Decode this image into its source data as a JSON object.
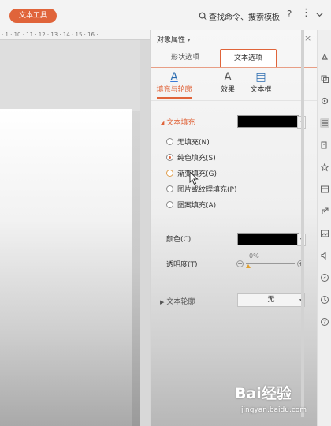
{
  "toolbar": {
    "tool_tab": "文本工具",
    "search_label": "查找命令、搜索模板",
    "help": "?",
    "more": "⋮"
  },
  "ruler": {
    "ticks": "· 1 · 10 · 11 · 12 · 13 · 14 · 15 · 16 ·"
  },
  "panel": {
    "title": "对象属性",
    "title_caret": "▾",
    "close": "×",
    "tabs": [
      {
        "label": "形状选项"
      },
      {
        "label": "文本选项",
        "active": true
      }
    ],
    "sub_tabs": [
      {
        "label": "填充与轮廓",
        "glyph": "A",
        "active": true
      },
      {
        "label": "效果",
        "glyph": "A"
      },
      {
        "label": "文本框",
        "glyph": "▤"
      }
    ],
    "fill_section": {
      "title": "文本填充",
      "color": "#000000",
      "options": [
        {
          "label": "无填充(N)",
          "selected": false
        },
        {
          "label": "纯色填充(S)",
          "selected": true
        },
        {
          "label": "渐变填充(G)",
          "selected": false,
          "hover": true
        },
        {
          "label": "图片或纹理填充(P)",
          "selected": false
        },
        {
          "label": "图案填充(A)",
          "selected": false
        }
      ],
      "color_label": "颜色(C)",
      "color_value": "#000000",
      "transparency_label": "透明度(T)",
      "transparency_percent": "0%",
      "transparency_value": 0
    },
    "outline_section": {
      "title": "文本轮廓",
      "value": "无"
    }
  },
  "rail": {
    "icons": [
      "shape-icon",
      "clip-icon",
      "settings-icon",
      "properties-icon",
      "copy-icon",
      "star-icon",
      "layout-icon",
      "share-icon",
      "image-icon",
      "speaker-icon",
      "compass-icon",
      "history-icon",
      "help-icon"
    ]
  },
  "watermark": {
    "brand": "Bai经验",
    "url": "jingyan.baidu.com"
  },
  "colors": {
    "accent": "#e0643a",
    "link_blue": "#2b6cb0"
  }
}
